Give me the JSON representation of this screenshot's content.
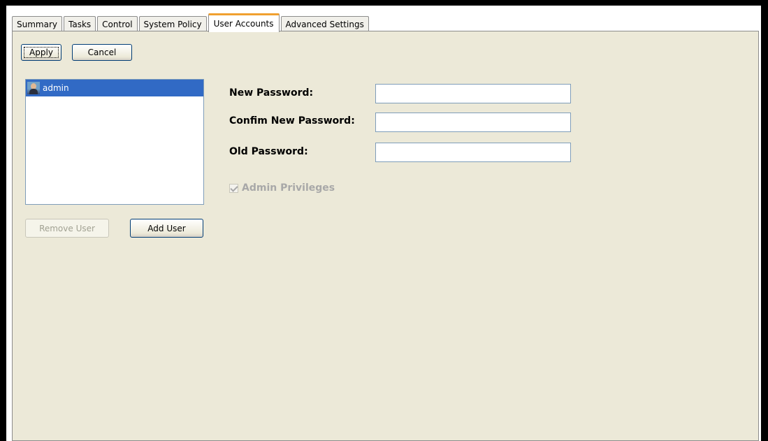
{
  "tabs": [
    {
      "label": "Summary",
      "active": false
    },
    {
      "label": "Tasks",
      "active": false
    },
    {
      "label": "Control",
      "active": false
    },
    {
      "label": "System Policy",
      "active": false
    },
    {
      "label": "User Accounts",
      "active": true
    },
    {
      "label": "Advanced Settings",
      "active": false
    }
  ],
  "toolbar": {
    "apply_label": "Apply",
    "cancel_label": "Cancel"
  },
  "users": {
    "items": [
      {
        "name": "admin",
        "icon": "user-avatar-icon",
        "selected": true
      }
    ],
    "remove_label": "Remove User",
    "add_label": "Add User"
  },
  "form": {
    "new_password_label": "New Password:",
    "new_password_value": "",
    "confirm_password_label": "Confim New Password:",
    "confirm_password_value": "",
    "old_password_label": "Old Password:",
    "old_password_value": "",
    "admin_privileges_label": "Admin Privileges",
    "admin_privileges_checked": true,
    "admin_privileges_enabled": false
  },
  "colors": {
    "panel_bg": "#ece9d8",
    "selection_bg": "#316ac5",
    "active_tab_accent": "#f0a030",
    "button_border": "#003c74",
    "disabled_text": "#a8a8a8"
  }
}
